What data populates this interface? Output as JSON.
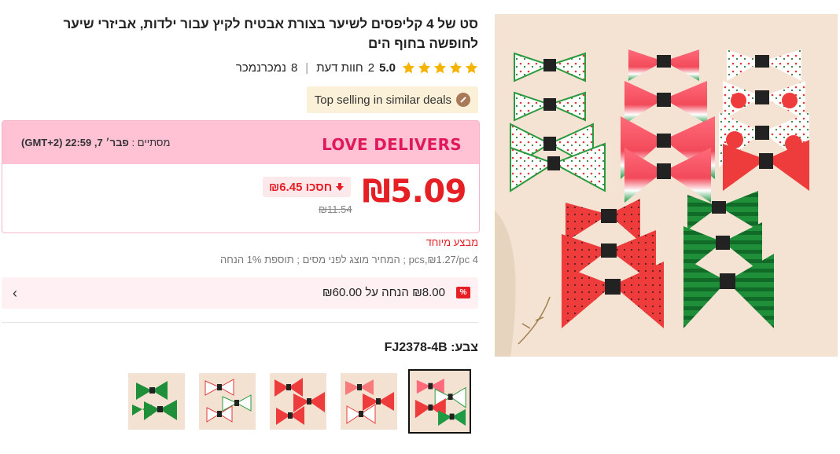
{
  "product": {
    "title": "סט של 4 קליפסים לשיער בצורת אבטיח לקיץ עבור ילדות, אביזרי שיער לחופשה בחוף הים",
    "rating_score": "5.0",
    "stars": 5,
    "reviews_count": "2",
    "reviews_label": "חוות דעת",
    "sold_count": "8",
    "sold_label": "נמכרנמכר",
    "top_selling": "Top selling in similar deals"
  },
  "deal": {
    "title": "LOVE DELIVERS",
    "ends_label": "מסתיים :",
    "ends_value": "פבר׳ 7, 22:59 (GMT+2)",
    "price": "₪5.09",
    "save_text": "₪6.45 חסכו",
    "original_price": "₪11.54"
  },
  "special_offer": "מבצע מיוחד",
  "unit_info": "4 pcs,₪1.27/pc ; המחיר מוצג לפני מסים ; תוספת 1% הנחה",
  "coupon": {
    "text": "₪8.00 הנחה על ₪60.00",
    "icon": "%"
  },
  "color": {
    "label": "צבע:",
    "value": "FJ2378-4B"
  },
  "colors": {
    "accent": "#e61f25",
    "deal_pink": "#ffc2d5",
    "star": "#f5b400",
    "green": "#2a9a3e"
  },
  "icons": {
    "star": "star-icon",
    "badge": "medal-icon",
    "save": "down-arrow-icon",
    "coupon_chevron": "chevron-left-icon"
  }
}
